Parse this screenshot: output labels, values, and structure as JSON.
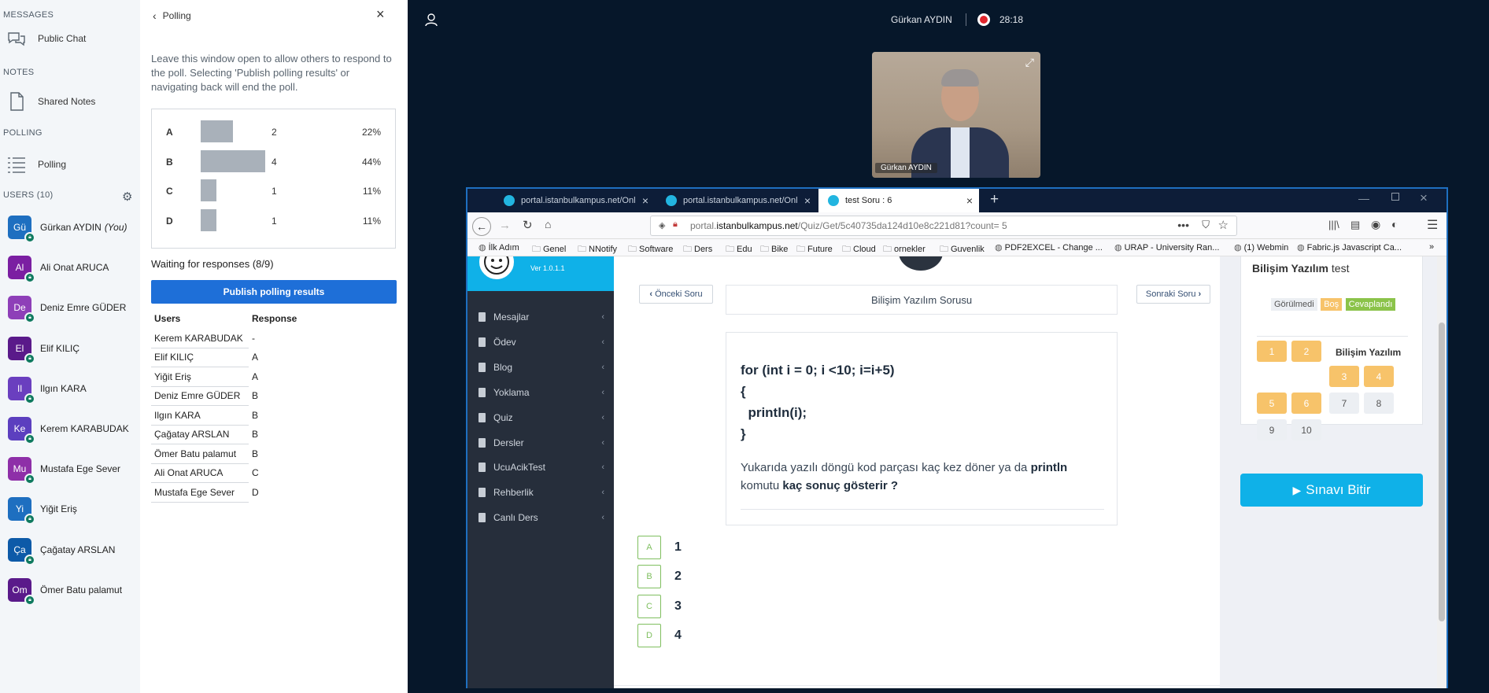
{
  "sidebar": {
    "messages_title": "MESSAGES",
    "public_chat": "Public Chat",
    "notes_title": "NOTES",
    "shared_notes": "Shared Notes",
    "polling_title": "POLLING",
    "polling": "Polling",
    "users_title": "USERS (10)",
    "users": [
      {
        "initials": "Gü",
        "name": "Gürkan AYDIN",
        "suffix": "(You)",
        "color": "#1e6fc0"
      },
      {
        "initials": "Al",
        "name": "Ali Onat ARUCA",
        "color": "#7b1fa2"
      },
      {
        "initials": "De",
        "name": "Deniz Emre GÜDER",
        "color": "#8e3fb8"
      },
      {
        "initials": "El",
        "name": "Elif KILIÇ",
        "color": "#5a1a8a"
      },
      {
        "initials": "Il",
        "name": "Ilgın KARA",
        "color": "#6a3fbf"
      },
      {
        "initials": "Ke",
        "name": "Kerem KARABUDAK",
        "color": "#5c3fbf"
      },
      {
        "initials": "Mu",
        "name": "Mustafa Ege Sever",
        "color": "#8e2fa8"
      },
      {
        "initials": "Yi",
        "name": "Yiğit Eriş",
        "color": "#1e6fc0"
      },
      {
        "initials": "Ça",
        "name": "Çağatay ARSLAN",
        "color": "#0d5aa8"
      },
      {
        "initials": "Om",
        "name": "Ömer Batu palamut",
        "color": "#5a1a8a"
      }
    ]
  },
  "poll": {
    "title": "Polling",
    "instructions": "Leave this window open to allow others to respond to the poll. Selecting 'Publish polling results' or navigating back will end the poll.",
    "results": [
      {
        "key": "A",
        "count": "2",
        "percent": "22%",
        "fraction": 0.22
      },
      {
        "key": "B",
        "count": "4",
        "percent": "44%",
        "fraction": 0.44
      },
      {
        "key": "C",
        "count": "1",
        "percent": "11%",
        "fraction": 0.11
      },
      {
        "key": "D",
        "count": "1",
        "percent": "11%",
        "fraction": 0.11
      }
    ],
    "waiting": "Waiting for responses (8/9)",
    "publish_button": "Publish polling results",
    "table_headers": [
      "Users",
      "Response"
    ],
    "responses": [
      [
        "Kerem KARABUDAK",
        "-"
      ],
      [
        "Elif KILIÇ",
        "A"
      ],
      [
        "Yiğit Eriş",
        "A"
      ],
      [
        "Deniz Emre GÜDER",
        "B"
      ],
      [
        "Ilgın KARA",
        "B"
      ],
      [
        "Çağatay ARSLAN",
        "B"
      ],
      [
        "Ömer Batu palamut",
        "B"
      ],
      [
        "Ali Onat ARUCA",
        "C"
      ],
      [
        "Mustafa Ege Sever",
        "D"
      ]
    ]
  },
  "header": {
    "presenter": "Gürkan AYDIN",
    "timer": "28:18",
    "video_label": "Gürkan AYDIN"
  },
  "browser": {
    "tabs": [
      "portal.istanbulkampus.net/Onl",
      "portal.istanbulkampus.net/Onl",
      "test Soru : 6"
    ],
    "url_prefix": "portal.",
    "url_domain": "istanbulkampus.net",
    "url_path": "/Quiz/Get/5c40735da124d10e8c221d81?count= 5",
    "bookmarks": [
      "İlk Adım",
      "Genel",
      "NNotify",
      "Software",
      "Ders",
      "Edu",
      "Bike",
      "Future",
      "Cloud",
      "ornekler",
      "Guvenlik",
      "PDF2EXCEL - Change ...",
      "URAP - University Ran...",
      "(1) Webmin",
      "Fabric.js Javascript Ca..."
    ]
  },
  "portal": {
    "version": "Ver 1.0.1.1",
    "menu": [
      "Mesajlar",
      "Ödev",
      "Blog",
      "Yoklama",
      "Quiz",
      "Dersler",
      "UcuAcikTest",
      "Rehberlik",
      "Canlı Ders"
    ],
    "prev": "Önceki Soru",
    "next": "Sonraki Soru",
    "question_title": "Bilişim Yazılım Sorusu",
    "code": [
      "for (int i = 0; i <10; i=i+5)",
      "{",
      "  println(i);",
      "}"
    ],
    "question_part1": "Yukarıda yazılı döngü kod parçası kaç kez döner ya da ",
    "question_bold1": "println",
    "question_part2": " komutu ",
    "question_bold2": "kaç sonuç gösterir ?",
    "options": [
      {
        "key": "A",
        "value": "1"
      },
      {
        "key": "B",
        "value": "2"
      },
      {
        "key": "C",
        "value": "3"
      },
      {
        "key": "D",
        "value": "4"
      }
    ],
    "test_title_bold": "Bilişim Yazılım",
    "test_title_rest": " test",
    "legend": [
      "Görülmedi",
      "Boş",
      "Cevaplandı"
    ],
    "group_label": "Bilişim Yazılım",
    "numbers": [
      "1",
      "2",
      "3",
      "4",
      "5",
      "6",
      "7",
      "8",
      "9",
      "10"
    ],
    "finish": "Sınavı Bitir"
  }
}
